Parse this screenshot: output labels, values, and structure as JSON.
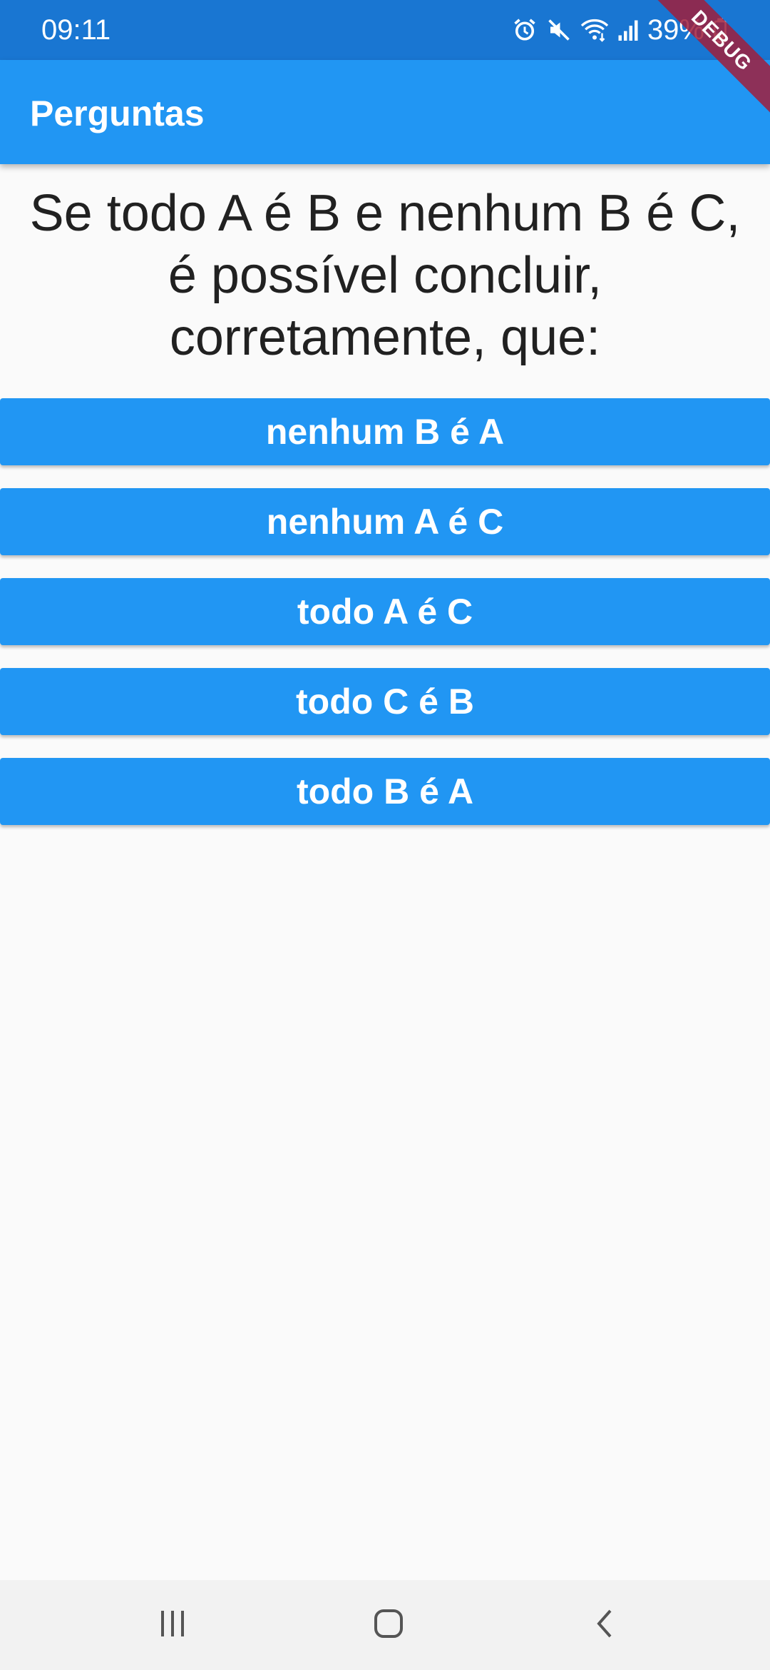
{
  "status_bar": {
    "time": "09:11",
    "battery_percent": "39%",
    "icons": [
      "alarm-icon",
      "mute-icon",
      "wifi-icon",
      "signal-icon",
      "battery-icon"
    ]
  },
  "debug_banner": "DEBUG",
  "app_bar": {
    "title": "Perguntas"
  },
  "question": {
    "text": "Se todo A é B e nenhum B é C, é possível concluir, corretamente, que:"
  },
  "answers": [
    {
      "label": "nenhum B é A"
    },
    {
      "label": "nenhum A é C"
    },
    {
      "label": "todo A é C"
    },
    {
      "label": "todo C é B"
    },
    {
      "label": "todo B é A"
    }
  ],
  "nav_bar": {
    "icons": [
      "recents-icon",
      "home-icon",
      "back-icon"
    ]
  },
  "colors": {
    "status_bar": "#1976d2",
    "primary": "#2196f3",
    "background": "#fafafa",
    "text": "#212121",
    "on_primary": "#ffffff"
  }
}
